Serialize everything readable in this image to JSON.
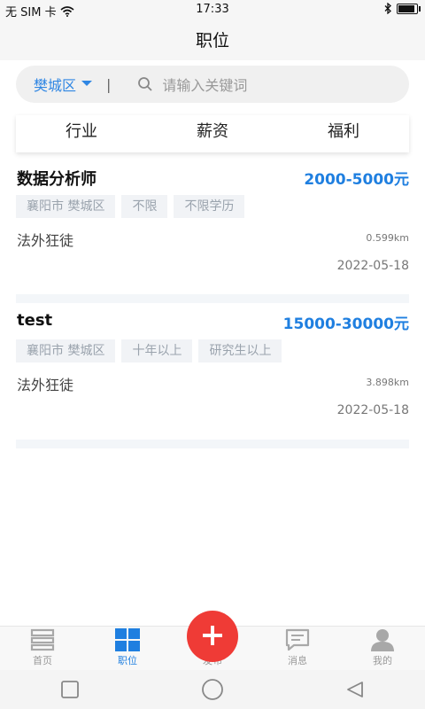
{
  "status_bar": {
    "carrier": "无 SIM 卡",
    "time": "17:33"
  },
  "header": {
    "title": "职位"
  },
  "search": {
    "district": "樊城区",
    "separator": "|",
    "placeholder": "请输入关键词"
  },
  "filters": [
    "行业",
    "薪资",
    "福利"
  ],
  "jobs": [
    {
      "title": "数据分析师",
      "salary": "2000-5000元",
      "tags": [
        "襄阳市 樊城区",
        "不限",
        "不限学历"
      ],
      "company": "法外狂徒",
      "distance": "0.599km",
      "date": "2022-05-18"
    },
    {
      "title": "test",
      "salary": "15000-30000元",
      "tags": [
        "襄阳市 樊城区",
        "十年以上",
        "研究生以上"
      ],
      "company": "法外狂徒",
      "distance": "3.898km",
      "date": "2022-05-18"
    }
  ],
  "tabbar": {
    "items": [
      {
        "label": "首页",
        "icon": "home-icon"
      },
      {
        "label": "职位",
        "icon": "grid-icon",
        "active": true
      },
      {
        "label": "发布",
        "icon": "plus-icon"
      },
      {
        "label": "消息",
        "icon": "message-icon"
      },
      {
        "label": "我的",
        "icon": "user-icon"
      }
    ]
  },
  "colors": {
    "accent": "#1f7fe0",
    "publish": "#ef3b36"
  }
}
